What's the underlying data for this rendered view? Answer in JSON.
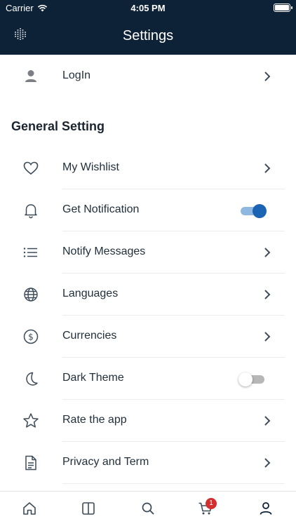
{
  "status_bar": {
    "carrier": "Carrier",
    "time": "4:05 PM"
  },
  "header": {
    "title": "Settings"
  },
  "login_row": {
    "label": "LogIn",
    "icon": "person-icon"
  },
  "general_section": {
    "title": "General Setting",
    "items": [
      {
        "label": "My Wishlist",
        "icon": "heart-icon",
        "control": "chevron"
      },
      {
        "label": "Get Notification",
        "icon": "bell-icon",
        "control": "toggle",
        "enabled": true
      },
      {
        "label": "Notify Messages",
        "icon": "list-icon",
        "control": "chevron"
      },
      {
        "label": "Languages",
        "icon": "globe-icon",
        "control": "chevron"
      },
      {
        "label": "Currencies",
        "icon": "dollar-icon",
        "control": "chevron"
      },
      {
        "label": "Dark Theme",
        "icon": "moon-icon",
        "control": "toggle",
        "enabled": false
      },
      {
        "label": "Rate the app",
        "icon": "star-icon",
        "control": "chevron"
      },
      {
        "label": "Privacy and Term",
        "icon": "document-icon",
        "control": "chevron"
      }
    ]
  },
  "tab_bar": {
    "items": [
      "home-icon",
      "book-icon",
      "search-icon",
      "cart-icon",
      "profile-icon"
    ],
    "cart_badge": "1",
    "active": "profile-icon"
  },
  "colors": {
    "header_bg": "#0e2237",
    "toggle_on": "#1b63b3",
    "badge": "#d32f2f",
    "icon": "#3d4b59"
  }
}
